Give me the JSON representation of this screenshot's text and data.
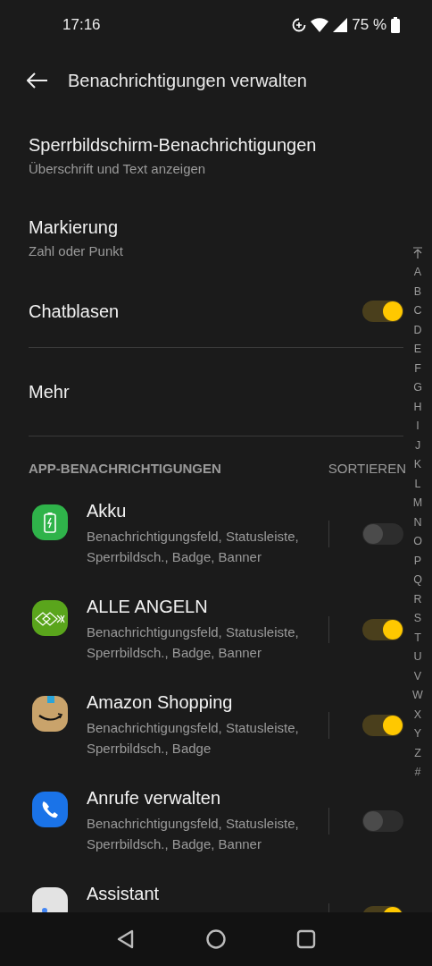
{
  "status_bar": {
    "time": "17:16",
    "battery": "75 %"
  },
  "header": {
    "title": "Benachrichtigungen verwalten"
  },
  "settings": [
    {
      "kind": "text",
      "title": "Sperrbildschirm-Benachrichtigungen",
      "subtitle": "Überschrift und Text anzeigen"
    },
    {
      "kind": "text",
      "title": "Markierung",
      "subtitle": "Zahl oder Punkt"
    },
    {
      "kind": "toggle",
      "title": "Chatblasen",
      "on": true
    },
    {
      "kind": "link",
      "title": "Mehr"
    }
  ],
  "section": {
    "title": "APP-BENACHRICHTIGUNGEN",
    "action": "SORTIEREN"
  },
  "apps": [
    {
      "name": "Akku",
      "subtitle": "Benachrichtigungsfeld, Statusleiste, Sperrbildsch., Badge, Banner",
      "on": false
    },
    {
      "name": "ALLE ANGELN",
      "subtitle": "Benachrichtigungsfeld, Statusleiste, Sperrbildsch., Badge, Banner",
      "on": true
    },
    {
      "name": "Amazon Shopping",
      "subtitle": "Benachrichtigungsfeld, Statusleiste, Sperrbildsch., Badge",
      "on": true
    },
    {
      "name": "Anrufe verwalten",
      "subtitle": "Benachrichtigungsfeld, Statusleiste, Sperrbildsch., Badge, Banner",
      "on": false
    },
    {
      "name": "Assistant",
      "on": true
    }
  ],
  "index": [
    "A",
    "B",
    "C",
    "D",
    "E",
    "F",
    "G",
    "H",
    "I",
    "J",
    "K",
    "L",
    "M",
    "N",
    "O",
    "P",
    "Q",
    "R",
    "S",
    "T",
    "U",
    "V",
    "W",
    "X",
    "Y",
    "Z",
    "#"
  ]
}
